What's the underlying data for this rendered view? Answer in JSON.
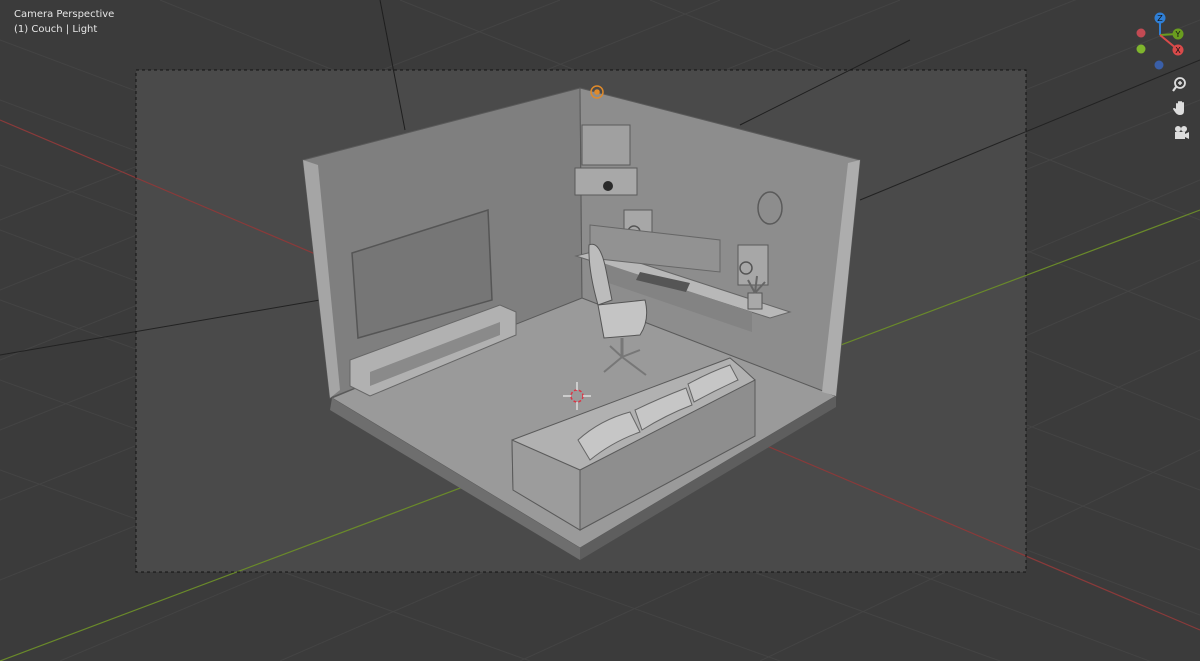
{
  "viewport": {
    "mode_label": "Camera Perspective",
    "object_label": "(1) Couch | Light"
  },
  "gizmo": {
    "axes": [
      {
        "label": "Z",
        "color": "#2f7fd6"
      },
      {
        "label": "Y",
        "color": "#6a9d1f"
      },
      {
        "label": "X",
        "color": "#d94a4a"
      }
    ],
    "negative_axes": [
      {
        "axis": "-X",
        "color": "#c24a53"
      },
      {
        "axis": "-Y",
        "color": "#7fb52d"
      },
      {
        "axis": "-Z",
        "color": "#3a5fa8"
      }
    ]
  },
  "navigation_tools": [
    {
      "name": "zoom-icon",
      "tooltip": ""
    },
    {
      "name": "hand-pan-icon",
      "tooltip": ""
    },
    {
      "name": "camera-view-icon",
      "tooltip": ""
    }
  ],
  "colors": {
    "background": "#3b3b3b",
    "camera_frame": "#4a4a4a",
    "x_axis": "#8a3a3a",
    "y_axis": "#6a8a2a",
    "model": "#8e8e8e"
  }
}
